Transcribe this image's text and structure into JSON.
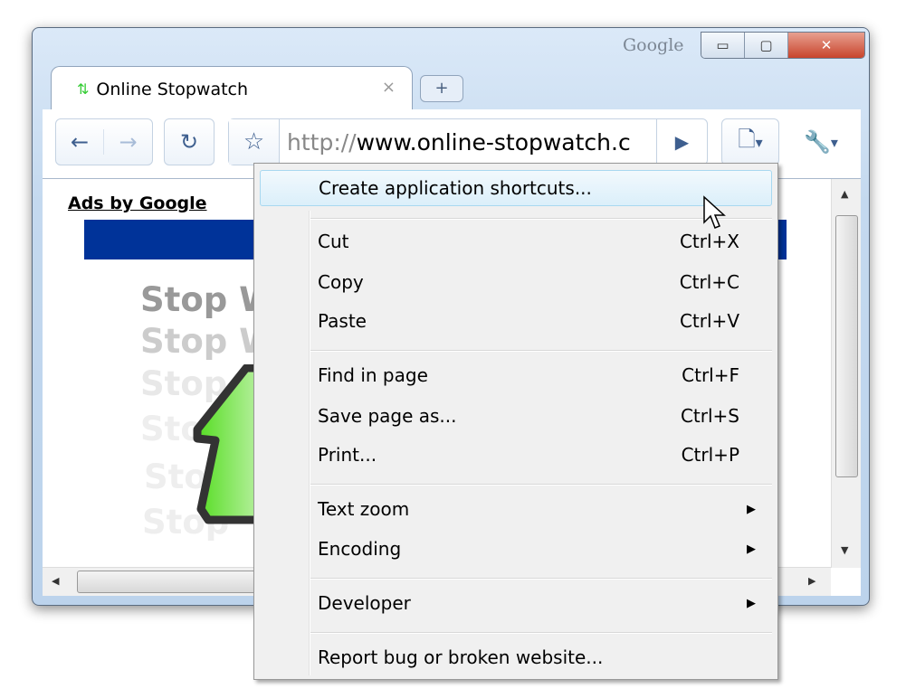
{
  "window": {
    "brand": "Google",
    "minimize": "▭",
    "maximize": "▢",
    "close": "✕"
  },
  "tab": {
    "title": "Online Stopwatch",
    "close": "×",
    "new_tab": "+"
  },
  "toolbar": {
    "back": "←",
    "forward": "→",
    "reload": "↻",
    "star": "☆",
    "url_scheme": "http://",
    "url_rest": "www.online-stopwatch.c",
    "go": "▶",
    "page_menu": "▾",
    "wrench_menu": "▾"
  },
  "page": {
    "ads": "Ads by Google",
    "stop_lines": [
      "Stop W",
      "Stop W",
      "Stop",
      "Sto",
      "Sto",
      "Stop"
    ]
  },
  "menu": {
    "items": [
      {
        "label": "Create application shortcuts...",
        "shortcut": ""
      },
      {
        "label": "Cut",
        "shortcut": "Ctrl+X"
      },
      {
        "label": "Copy",
        "shortcut": "Ctrl+C"
      },
      {
        "label": "Paste",
        "shortcut": "Ctrl+V"
      },
      {
        "label": "Find in page",
        "shortcut": "Ctrl+F"
      },
      {
        "label": "Save page as...",
        "shortcut": "Ctrl+S"
      },
      {
        "label": "Print...",
        "shortcut": "Ctrl+P"
      },
      {
        "label": "Text zoom",
        "submenu": "▶"
      },
      {
        "label": "Encoding",
        "submenu": "▶"
      },
      {
        "label": "Developer",
        "submenu": "▶"
      },
      {
        "label": "Report bug or broken website...",
        "shortcut": ""
      }
    ]
  },
  "colors": {
    "ad_bar": "#003399",
    "menu_highlight": "#dbeffa",
    "arrow_green": "#66dd33"
  }
}
